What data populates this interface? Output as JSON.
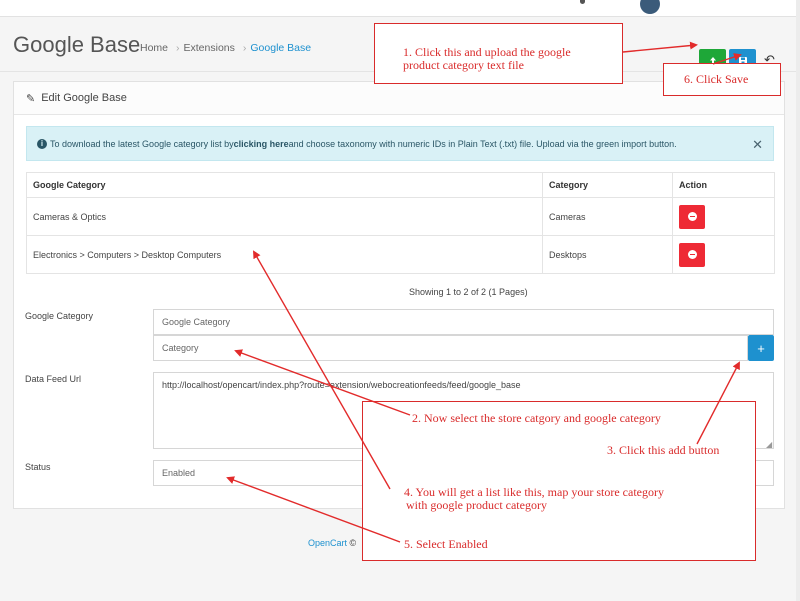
{
  "header": {
    "title": "Google Base",
    "breadcrumb": [
      "Home",
      "Extensions",
      "Google Base"
    ]
  },
  "panel": {
    "heading": "Edit Google Base"
  },
  "alert": {
    "text_before": "To download the latest Google category list by ",
    "link_text": "clicking here",
    "text_after": " and choose taxonomy with numeric IDs in Plain Text (.txt) file. Upload via the green import button."
  },
  "table": {
    "headers": [
      "Google Category",
      "Category",
      "Action"
    ],
    "rows": [
      {
        "google": "Cameras & Optics",
        "category": "Cameras"
      },
      {
        "google": "Electronics > Computers > Desktop Computers",
        "category": "Desktops"
      }
    ]
  },
  "pagination": {
    "showing": "Showing 1 to 2 of 2 (1 Pages)"
  },
  "form": {
    "google_category_label": "Google Category",
    "google_category_placeholder": "Google Category",
    "category_placeholder": "Category",
    "data_feed_label": "Data Feed Url",
    "data_feed_value": "http://localhost/opencart/index.php?route=extension/webocreationfeeds/feed/google_base",
    "status_label": "Status",
    "status_value": "Enabled"
  },
  "footer": {
    "link": "OpenCart",
    "symbol": "©"
  },
  "annotations": {
    "n1_line1": "1. Click this and upload the google",
    "n1_line2": "product category text file",
    "n6": "6. Click Save",
    "n2": "2. Now select the store catgory and google category",
    "n3": "3. Click this add button",
    "n4_line1": "4. You will get a list like this, map your store category",
    "n4_line2": "with google product category",
    "n5": "5. Select Enabled"
  },
  "colors": {
    "accent": "#1e91cf",
    "import": "#1ea738",
    "danger": "#ee2a35",
    "annotation": "#d92b2b"
  }
}
